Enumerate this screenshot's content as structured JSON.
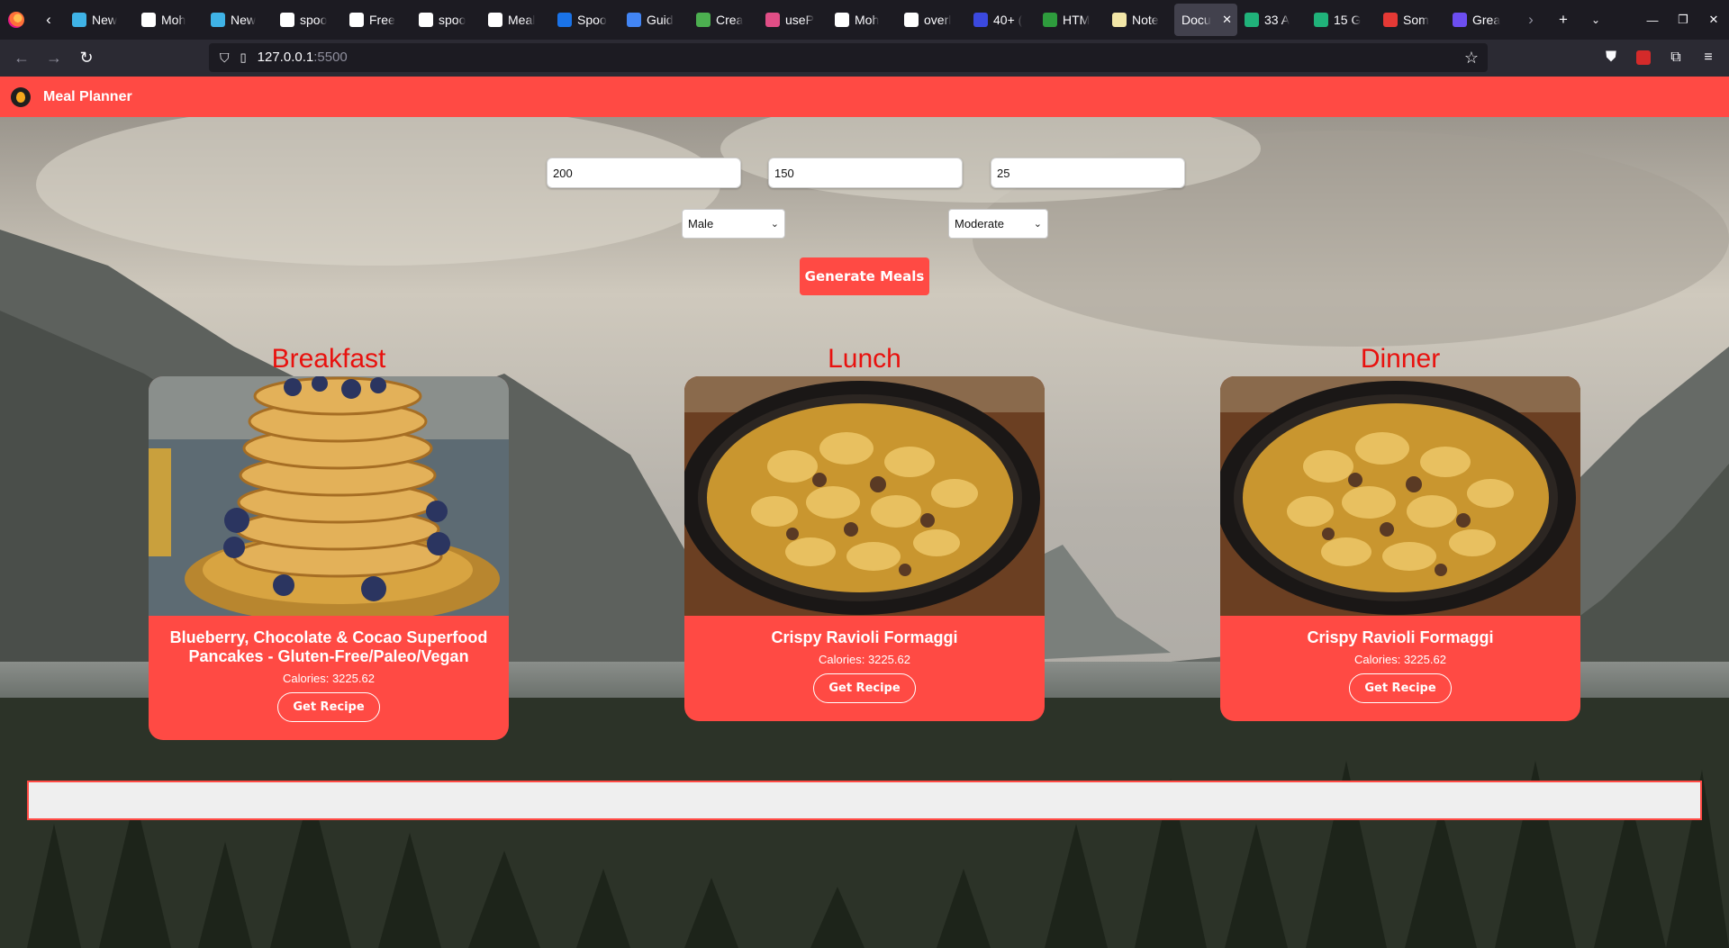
{
  "browser": {
    "tabs": [
      {
        "label": "New",
        "icon": "globe-icon",
        "color": "#3fb3e6"
      },
      {
        "label": "Moh",
        "icon": "github-icon",
        "color": "#ffffff"
      },
      {
        "label": "New",
        "icon": "globe-icon",
        "color": "#3fb3e6"
      },
      {
        "label": "spoo",
        "icon": "spoonacular-icon",
        "color": "#ffffff"
      },
      {
        "label": "Free",
        "icon": "spoonacular-icon",
        "color": "#ffffff"
      },
      {
        "label": "spoo",
        "icon": "spoonacular-icon",
        "color": "#ffffff"
      },
      {
        "label": "Meal",
        "icon": "notion-icon",
        "color": "#ffffff"
      },
      {
        "label": "Spoo",
        "icon": "search-icon",
        "color": "#1a73e8"
      },
      {
        "label": "Guid",
        "icon": "docs-icon",
        "color": "#4285f4"
      },
      {
        "label": "Crea",
        "icon": "leaf-icon",
        "color": "#4caf50"
      },
      {
        "label": "useP",
        "icon": "dots-icon",
        "color": "#e04e86"
      },
      {
        "label": "Moh",
        "icon": "github-icon",
        "color": "#ffffff"
      },
      {
        "label": "overl",
        "icon": "mdn-icon",
        "color": "#ffffff"
      },
      {
        "label": "40+ (",
        "icon": "dev-icon",
        "color": "#3b49df"
      },
      {
        "label": "HTM",
        "icon": "h-icon",
        "color": "#2e9c3d"
      },
      {
        "label": "Note",
        "icon": "note-icon",
        "color": "#f2e6a7"
      }
    ],
    "active_tab": {
      "label": "Docu",
      "close": "✕"
    },
    "tabs_after": [
      {
        "label": "33 A",
        "icon": "sheet-icon",
        "color": "#20b27a"
      },
      {
        "label": "15 G",
        "icon": "sheet-icon",
        "color": "#20b27a"
      },
      {
        "label": "Som",
        "icon": "bug-icon",
        "color": "#e53935"
      },
      {
        "label": "Grea",
        "icon": "six-icon",
        "color": "#6c4ef0"
      }
    ],
    "url_host": "127.0.0.1",
    "url_port": ":5500"
  },
  "app": {
    "title": "Meal Planner"
  },
  "form": {
    "weight": "200",
    "height": "150",
    "age": "25",
    "gender": "Male",
    "activity": "Moderate",
    "generate_label": "Generate Meals"
  },
  "meals": [
    {
      "heading": "Breakfast",
      "title": "Blueberry, Chocolate & Cocao Superfood Pancakes - Gluten-Free/Paleo/Vegan",
      "calories": "Calories: 3225.62",
      "button": "Get Recipe"
    },
    {
      "heading": "Lunch",
      "title": "Crispy Ravioli Formaggi",
      "calories": "Calories: 3225.62",
      "button": "Get Recipe"
    },
    {
      "heading": "Dinner",
      "title": "Crispy Ravioli Formaggi",
      "calories": "Calories: 3225.62",
      "button": "Get Recipe"
    }
  ],
  "colors": {
    "accent": "#ff4a44",
    "heading": "#e8110e"
  }
}
